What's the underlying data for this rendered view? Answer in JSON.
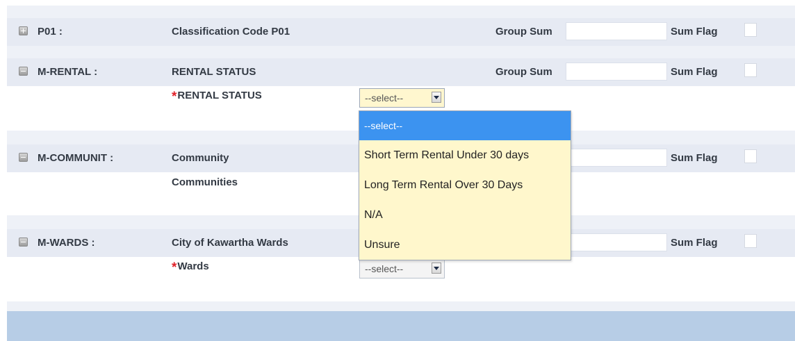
{
  "rows": [
    {
      "code": "P01 :",
      "description": "Classification Code P01",
      "group_label": "Group Sum",
      "flag_label": "Sum Flag"
    },
    {
      "code": "M-RENTAL :",
      "description": "RENTAL STATUS",
      "group_label": "Group Sum",
      "flag_label": "Sum Flag",
      "field": {
        "required_mark": "*",
        "label": "RENTAL STATUS",
        "selected": "--select--"
      }
    },
    {
      "code": "M-COMMUNIT :",
      "description": "Community",
      "flag_label": "Sum Flag",
      "field": {
        "label": "Communities"
      }
    },
    {
      "code": "M-WARDS :",
      "description": "City of Kawartha Wards",
      "flag_label": "Sum Flag",
      "field": {
        "required_mark": "*",
        "label": "Wards",
        "selected": "--select--"
      }
    }
  ],
  "dropdown": {
    "options": [
      "--select--",
      "Short Term Rental Under 30 days",
      "Long Term Rental Over 30 Days",
      "N/A",
      "Unsure"
    ],
    "highlighted_index": 0
  },
  "colors": {
    "highlight": "#3c93f0",
    "dropdown_background": "#fff7cc",
    "required": "#e0222a",
    "footer_band": "#b7cde6"
  }
}
